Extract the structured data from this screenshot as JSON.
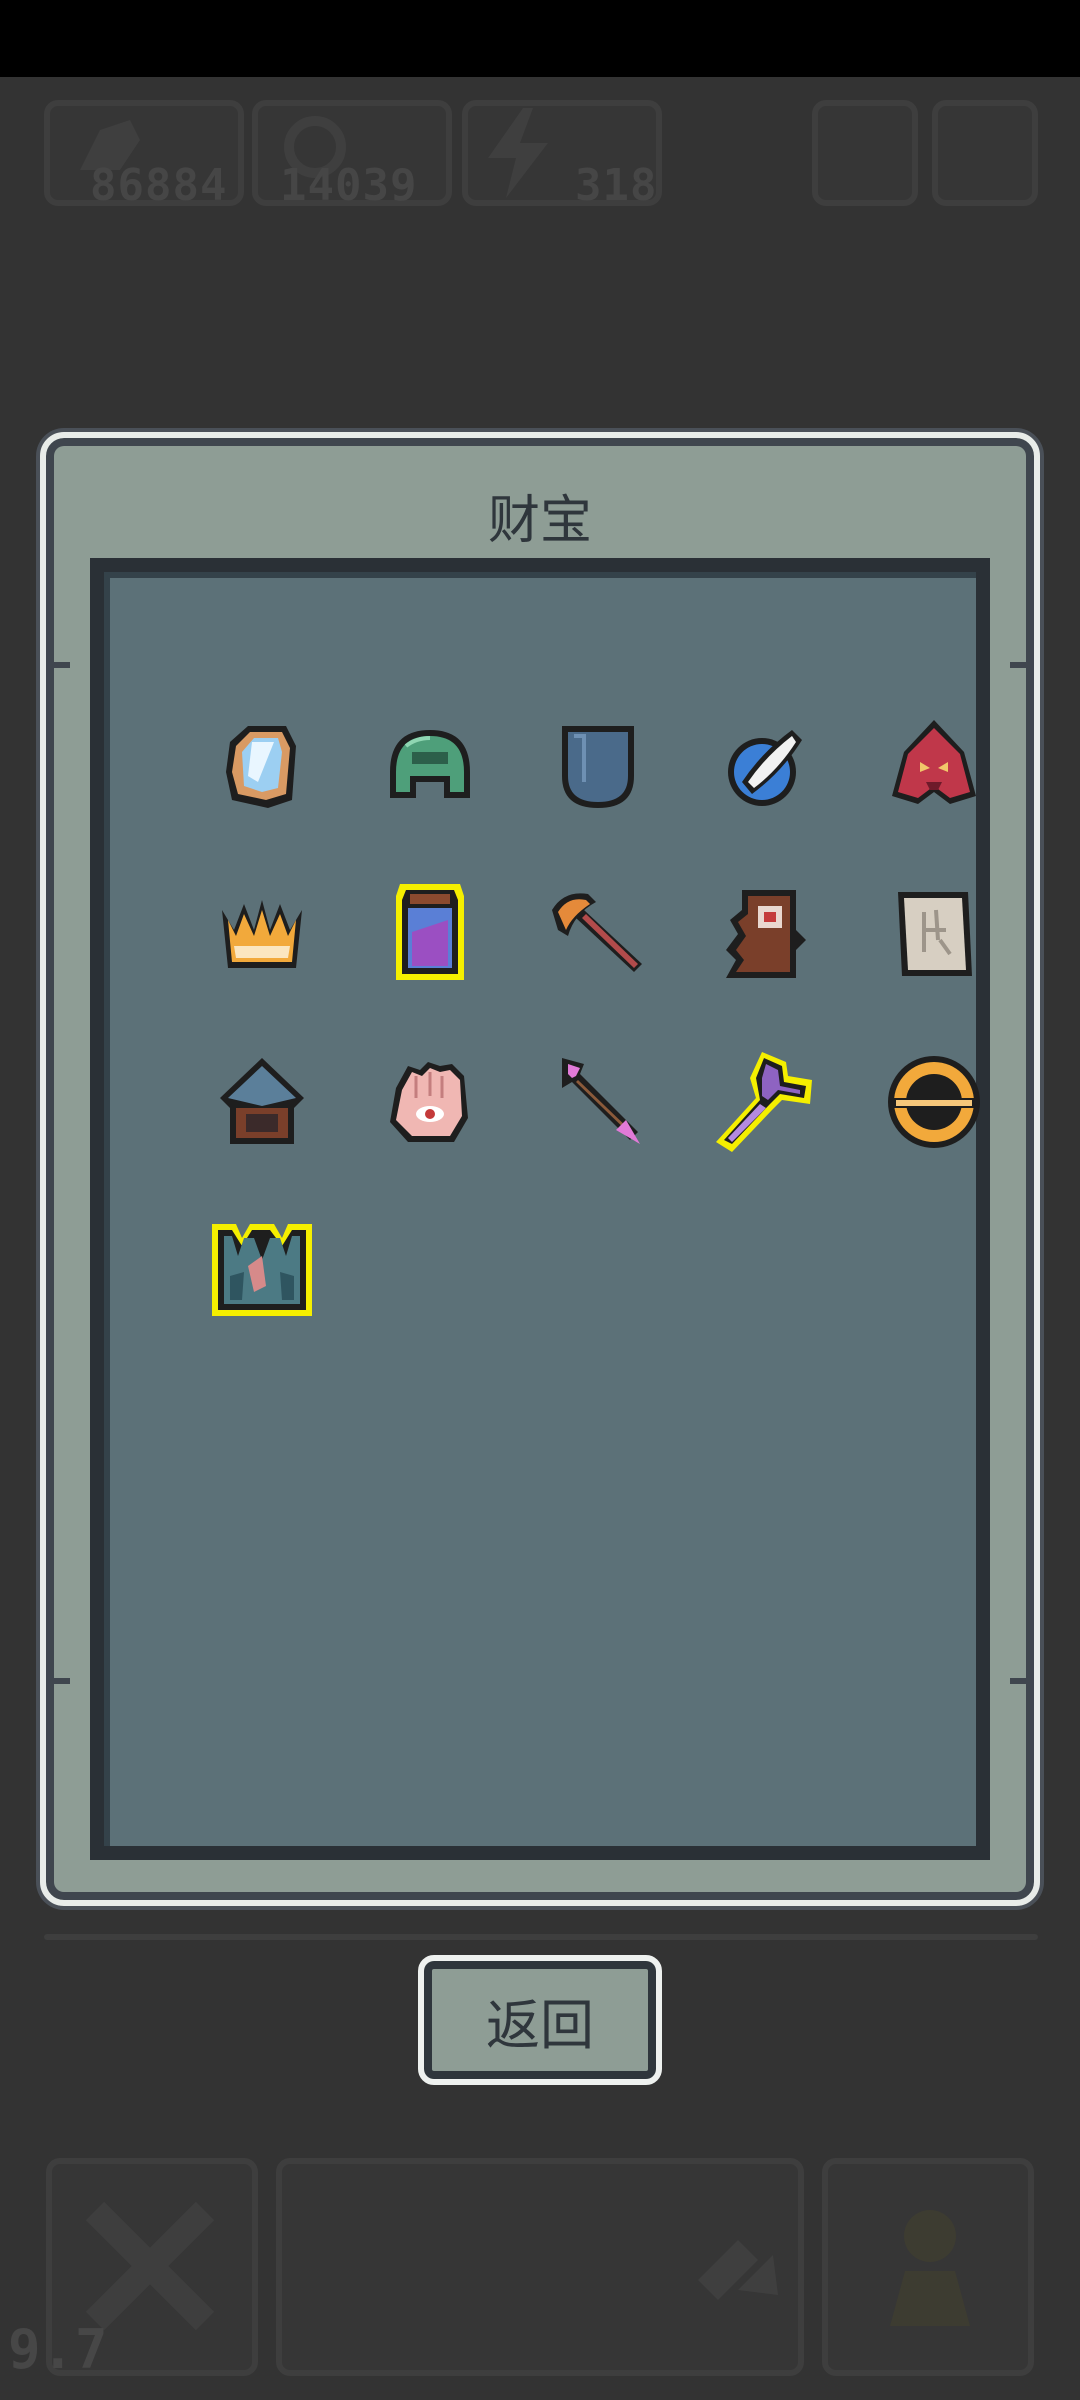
{
  "hud": {
    "resource_1": "86884",
    "resource_2": "14039",
    "resource_3": "318",
    "level": "9.7"
  },
  "dialog": {
    "title": "财宝",
    "return_label": "返回"
  },
  "treasures": [
    {
      "name": "crystal-shard-icon",
      "rare": false
    },
    {
      "name": "green-helmet-icon",
      "rare": false
    },
    {
      "name": "blue-shield-icon",
      "rare": false
    },
    {
      "name": "feathered-orb-icon",
      "rare": false
    },
    {
      "name": "red-mask-icon",
      "rare": false
    },
    {
      "name": "golden-crown-icon",
      "rare": false
    },
    {
      "name": "potion-jar-icon",
      "rare": true
    },
    {
      "name": "axe-icon",
      "rare": false
    },
    {
      "name": "wooden-totem-icon",
      "rare": false
    },
    {
      "name": "ancient-scroll-icon",
      "rare": false
    },
    {
      "name": "spiked-helm-icon",
      "rare": false
    },
    {
      "name": "eye-palm-icon",
      "rare": false
    },
    {
      "name": "magic-arrow-icon",
      "rare": false
    },
    {
      "name": "purple-hammer-icon",
      "rare": true
    },
    {
      "name": "ring-orb-icon",
      "rare": false
    },
    {
      "name": "ice-claw-icon",
      "rare": true
    }
  ],
  "colors": {
    "background": "#333333",
    "panel": "#8e9d95",
    "inner_panel": "#5c7178",
    "rare_outline": "#ffff00"
  }
}
